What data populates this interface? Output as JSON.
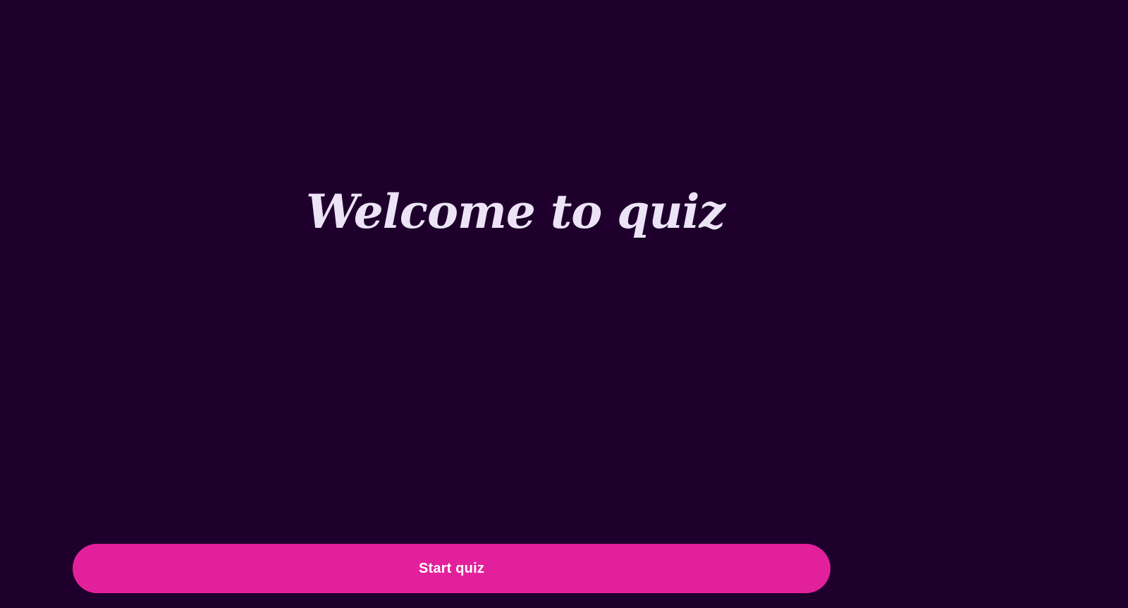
{
  "welcome": {
    "title": "Welcome to quiz"
  },
  "actions": {
    "start_label": "Start quiz"
  },
  "colors": {
    "background": "#1f002d",
    "title_text": "#ece3f7",
    "button_bg": "#e3209c",
    "button_text": "#ffffff"
  }
}
